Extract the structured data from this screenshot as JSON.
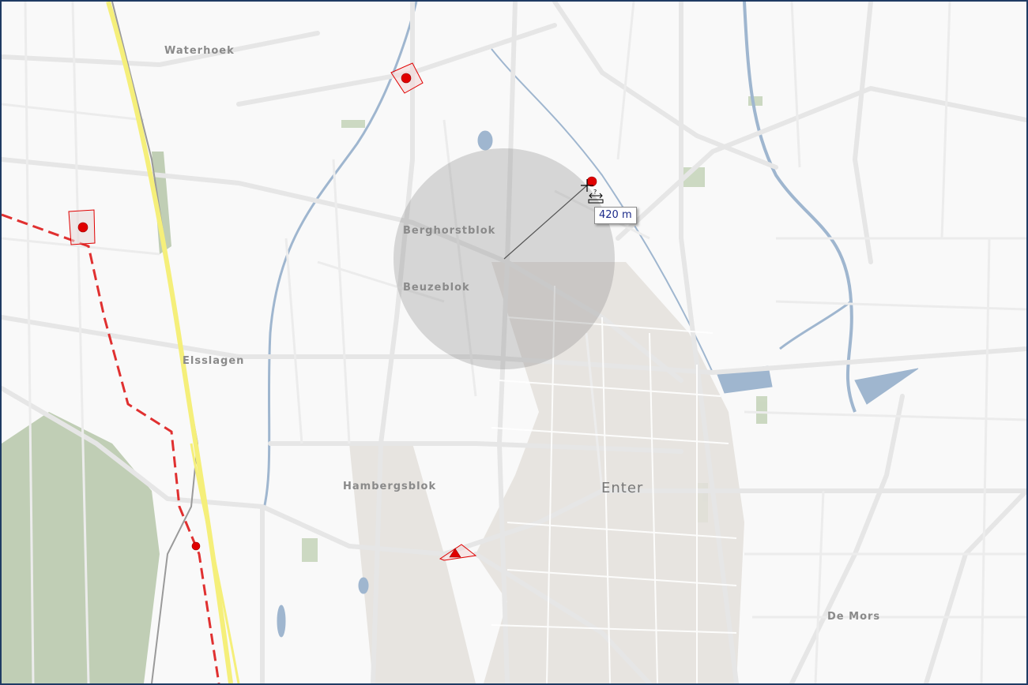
{
  "map": {
    "place_labels": [
      {
        "key": "waterhoek",
        "text": "Waterhoek"
      },
      {
        "key": "berghorstblok",
        "text": "Berghorstblok"
      },
      {
        "key": "beuzeblok",
        "text": "Beuzeblok"
      },
      {
        "key": "elsslagen",
        "text": "Elsslagen"
      },
      {
        "key": "hambergsblok",
        "text": "Hambergsblok"
      },
      {
        "key": "enter",
        "text": "Enter"
      },
      {
        "key": "de_mors",
        "text": "De Mors"
      }
    ],
    "measure": {
      "distance_label": "420 m"
    },
    "markers": [
      {
        "key": "north",
        "shape": "circle"
      },
      {
        "key": "west",
        "shape": "circle"
      },
      {
        "key": "target",
        "shape": "circle"
      },
      {
        "key": "southwest",
        "shape": "circle"
      },
      {
        "key": "south",
        "shape": "triangle"
      }
    ],
    "colors": {
      "background": "#f9f9f9",
      "road": "#e9e9e9",
      "water": "#9fb6cf",
      "forest": "#b9c9ad",
      "motorway": "#f5ef7a",
      "marker": "#e00000",
      "route": "#e03030",
      "buffer": "#8c8c8c"
    }
  }
}
